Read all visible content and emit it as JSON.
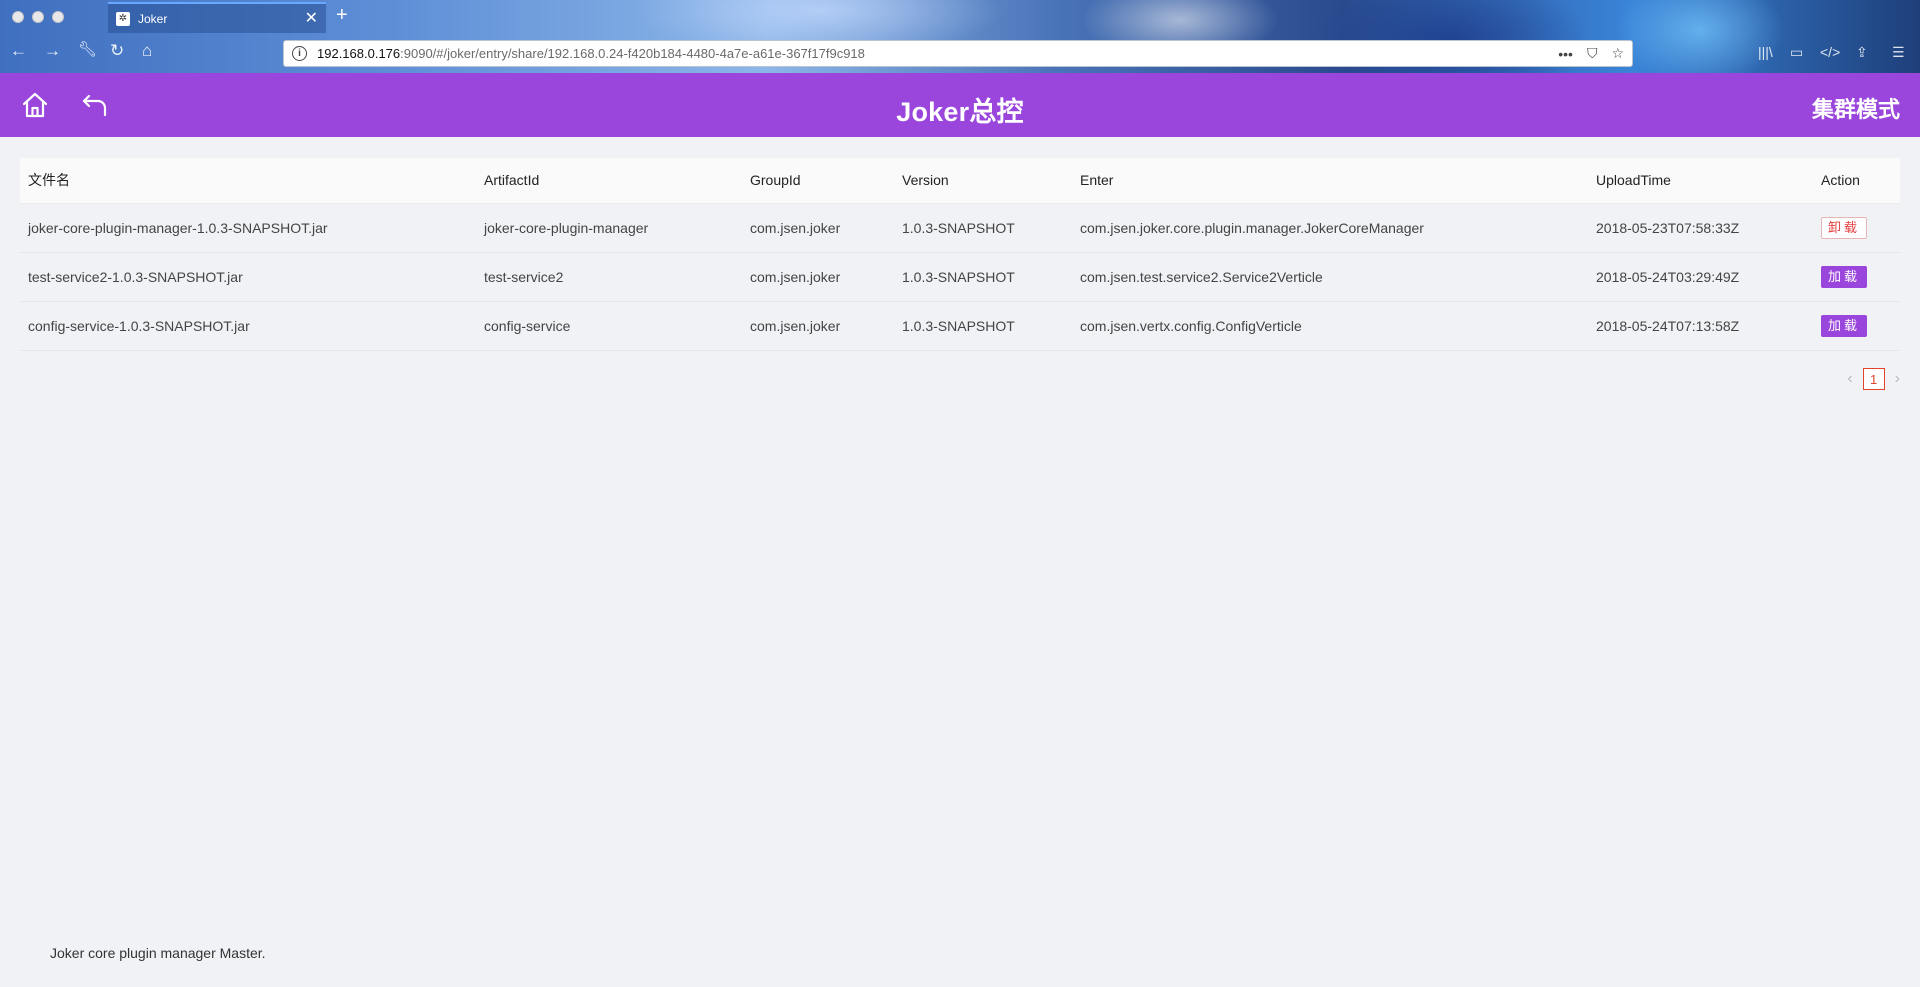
{
  "browser": {
    "tab_title": "Joker",
    "url_host": "192.168.0.176",
    "url_rest": ":9090/#/joker/entry/share/192.168.0.24-f420b184-4480-4a7e-a61e-367f17f9c918",
    "new_tab_symbol": "+",
    "close_tab_symbol": "✕",
    "more_symbol": "•••"
  },
  "header": {
    "title": "Joker总控",
    "mode": "集群模式",
    "bg_color": "#9a45db"
  },
  "table": {
    "columns": [
      "文件名",
      "ArtifactId",
      "GroupId",
      "Version",
      "Enter",
      "UploadTime",
      "Action"
    ],
    "rows": [
      {
        "file": "joker-core-plugin-manager-1.0.3-SNAPSHOT.jar",
        "artifact": "joker-core-plugin-manager",
        "group": "com.jsen.joker",
        "version": "1.0.3-SNAPSHOT",
        "enter": "com.jsen.joker.core.plugin.manager.JokerCoreManager",
        "upload": "2018-05-23T07:58:33Z",
        "action": "卸载"
      },
      {
        "file": "test-service2-1.0.3-SNAPSHOT.jar",
        "artifact": "test-service2",
        "group": "com.jsen.joker",
        "version": "1.0.3-SNAPSHOT",
        "enter": "com.jsen.test.service2.Service2Verticle",
        "upload": "2018-05-24T03:29:49Z",
        "action": "加载"
      },
      {
        "file": "config-service-1.0.3-SNAPSHOT.jar",
        "artifact": "config-service",
        "group": "com.jsen.joker",
        "version": "1.0.3-SNAPSHOT",
        "enter": "com.jsen.vertx.config.ConfigVerticle",
        "upload": "2018-05-24T07:13:58Z",
        "action": "加载"
      }
    ]
  },
  "pagination": {
    "current": "1",
    "prev": "‹",
    "next": "›"
  },
  "footer": {
    "text": "Joker core plugin manager Master."
  }
}
